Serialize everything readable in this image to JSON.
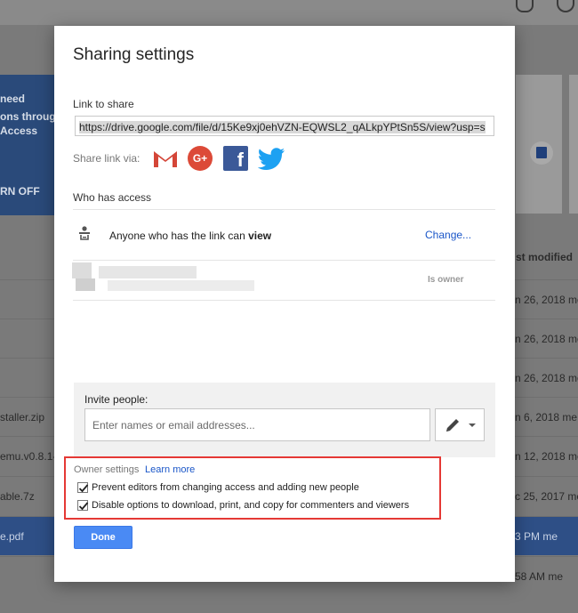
{
  "background": {
    "banner_lines": [
      "need",
      "ons through",
      "Access",
      "RN OFF"
    ],
    "last_modified_col": "st modified",
    "rows": [
      {
        "left": "",
        "right": "n 26, 2018 me"
      },
      {
        "left": "",
        "right": "n 26, 2018 me"
      },
      {
        "left": "",
        "right": "n 26, 2018 me"
      },
      {
        "left": "staller.zip",
        "right": "n 6, 2018 me"
      },
      {
        "left": "emu.v0.8.1-",
        "right": "n 12, 2018 me"
      },
      {
        "left": "able.7z",
        "right": "c 25, 2017 me"
      },
      {
        "left": "e.pdf",
        "right": "3 PM me"
      },
      {
        "left": "",
        "right": "58 AM me"
      }
    ]
  },
  "dialog": {
    "title": "Sharing settings",
    "link_label": "Link to share",
    "link_url": "https://drive.google.com/file/d/15Ke9xj0ehVZN-EQWSL2_qALkpYPtSn5S/view?usp=s",
    "share_via_label": "Share link via:",
    "social_icons": [
      "gmail-icon",
      "google-plus-icon",
      "facebook-icon",
      "twitter-icon"
    ],
    "gplus_text": "G+",
    "fb_text": "f",
    "who_label": "Who has access",
    "access_text": "Anyone who has the link can ",
    "access_mode": "view",
    "change_label": "Change...",
    "owner_badge": "Is owner",
    "invite_label": "Invite people:",
    "invite_placeholder": "Enter names or email addresses...",
    "owner_settings_label": "Owner settings",
    "learn_more_label": "Learn more",
    "option1_label": "Prevent editors from changing access and adding new people",
    "option2_label": "Disable options to download, print, and copy for commenters and viewers",
    "option1_checked": true,
    "option2_checked": true,
    "done_label": "Done"
  },
  "colors": {
    "accent": "#4a8af4",
    "link": "#1a56c8",
    "highlight_border": "#e53935",
    "gmail_red": "#d44638",
    "facebook": "#3b5998",
    "twitter": "#1da1f2"
  }
}
